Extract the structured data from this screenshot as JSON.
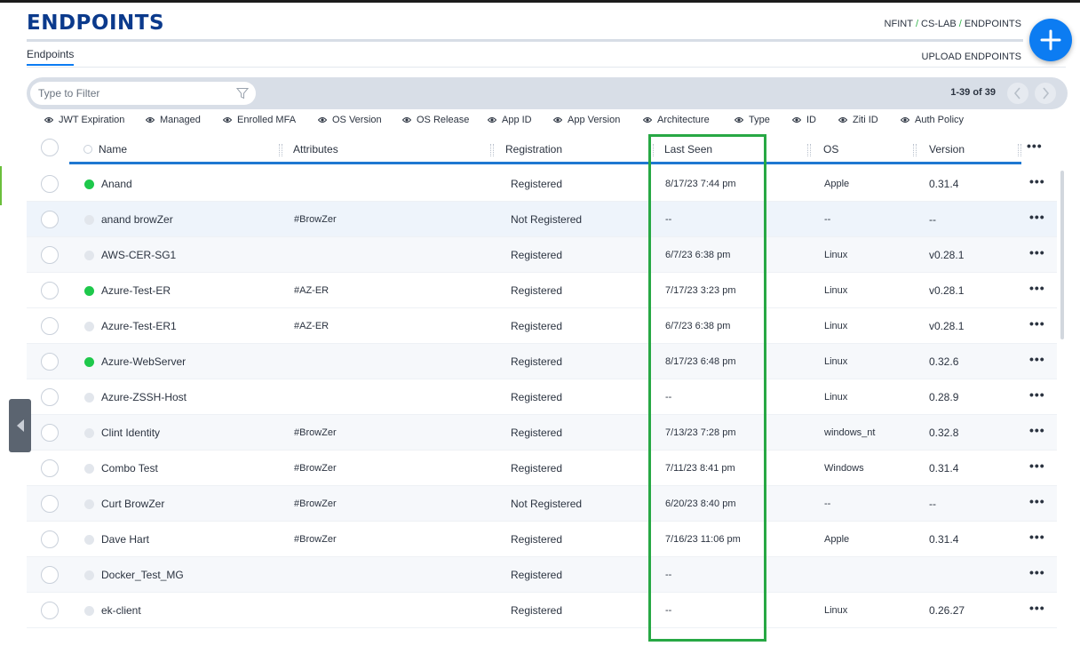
{
  "header": {
    "title": "ENDPOINTS",
    "breadcrumb": [
      "NFINT",
      "CS-LAB",
      "ENDPOINTS"
    ],
    "breadcrumb_separator": "/",
    "add_icon": "plus-icon"
  },
  "tabs": [
    {
      "label": "Endpoints",
      "active": true
    }
  ],
  "actions": {
    "upload_label": "UPLOAD ENDPOINTS"
  },
  "filter": {
    "placeholder": "Type to Filter",
    "value": "",
    "icon": "filter-icon"
  },
  "pagination": {
    "range": "1-39 of 39",
    "prev_icon": "chevron-left-icon",
    "next_icon": "chevron-right-icon"
  },
  "column_toggles": [
    "JWT Expiration",
    "Managed",
    "Enrolled MFA",
    "OS Version",
    "OS Release",
    "App ID",
    "App Version",
    "Architecture",
    "Type",
    "ID",
    "Ziti ID",
    "Auth Policy"
  ],
  "columns": [
    "Name",
    "Attributes",
    "Registration",
    "Last Seen",
    "OS",
    "Version"
  ],
  "more_icon": "more-horizontal-icon",
  "rows": [
    {
      "online": true,
      "name": "Anand",
      "attributes": "",
      "registration": "Registered",
      "last_seen": "8/17/23 7:44 pm",
      "os": "Apple",
      "version": "0.31.4"
    },
    {
      "online": false,
      "name": "anand browZer",
      "attributes": "#BrowZer",
      "registration": "Not Registered",
      "last_seen": "--",
      "os": "--",
      "version": "--"
    },
    {
      "online": false,
      "name": "AWS-CER-SG1",
      "attributes": "",
      "registration": "Registered",
      "last_seen": "6/7/23 6:38 pm",
      "os": "Linux",
      "version": "v0.28.1"
    },
    {
      "online": true,
      "name": "Azure-Test-ER",
      "attributes": "#AZ-ER",
      "registration": "Registered",
      "last_seen": "7/17/23 3:23 pm",
      "os": "Linux",
      "version": "v0.28.1"
    },
    {
      "online": false,
      "name": "Azure-Test-ER1",
      "attributes": "#AZ-ER",
      "registration": "Registered",
      "last_seen": "6/7/23 6:38 pm",
      "os": "Linux",
      "version": "v0.28.1"
    },
    {
      "online": true,
      "name": "Azure-WebServer",
      "attributes": "",
      "registration": "Registered",
      "last_seen": "8/17/23 6:48 pm",
      "os": "Linux",
      "version": "0.32.6"
    },
    {
      "online": false,
      "name": "Azure-ZSSH-Host",
      "attributes": "",
      "registration": "Registered",
      "last_seen": "--",
      "os": "Linux",
      "version": "0.28.9"
    },
    {
      "online": false,
      "name": "Clint Identity",
      "attributes": "#BrowZer",
      "registration": "Registered",
      "last_seen": "7/13/23 7:28 pm",
      "os": "windows_nt",
      "version": "0.32.8"
    },
    {
      "online": false,
      "name": "Combo Test",
      "attributes": "#BrowZer",
      "registration": "Registered",
      "last_seen": "7/11/23 8:41 pm",
      "os": "Windows",
      "version": "0.31.4"
    },
    {
      "online": false,
      "name": "Curt BrowZer",
      "attributes": "#BrowZer",
      "registration": "Not Registered",
      "last_seen": "6/20/23 8:40 pm",
      "os": "--",
      "version": "--"
    },
    {
      "online": false,
      "name": "Dave Hart",
      "attributes": "#BrowZer",
      "registration": "Registered",
      "last_seen": "7/16/23 11:06 pm",
      "os": "Apple",
      "version": "0.31.4"
    },
    {
      "online": false,
      "name": "Docker_Test_MG",
      "attributes": "",
      "registration": "Registered",
      "last_seen": "--",
      "os": "",
      "version": ""
    },
    {
      "online": false,
      "name": "ek-client",
      "attributes": "",
      "registration": "Registered",
      "last_seen": "--",
      "os": "Linux",
      "version": "0.26.27"
    }
  ],
  "colors": {
    "brand": "#0b3a8c",
    "accent": "#0c7cf2",
    "online": "#1ec84b",
    "highlight": "#27a844"
  }
}
